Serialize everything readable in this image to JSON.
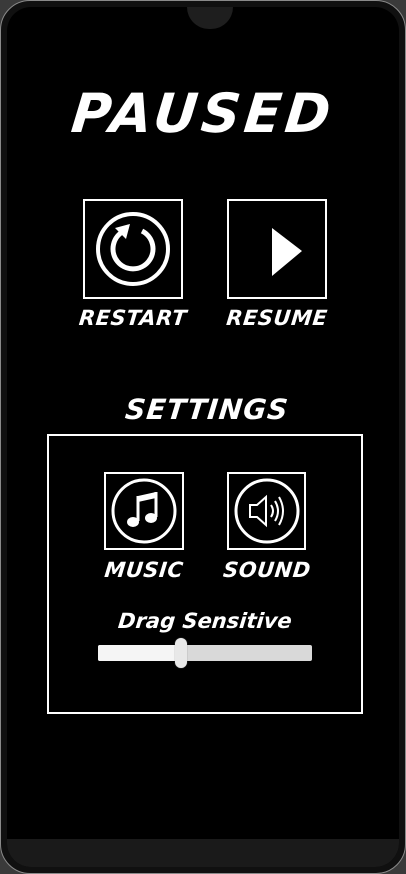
{
  "pause_menu": {
    "title": "PAUSED",
    "restart_label": "RESTART",
    "resume_label": "RESUME"
  },
  "settings": {
    "title": "SETTINGS",
    "music_label": "MUSIC",
    "sound_label": "SOUND",
    "drag_label": "Drag Sensitive",
    "drag_value": 0.39
  },
  "icons": {
    "restart": "restart-icon",
    "resume": "play-icon",
    "music": "music-note-icon",
    "sound": "speaker-icon"
  },
  "colors": {
    "background": "#000000",
    "foreground": "#ffffff",
    "slider_track": "#d9d9d9"
  }
}
